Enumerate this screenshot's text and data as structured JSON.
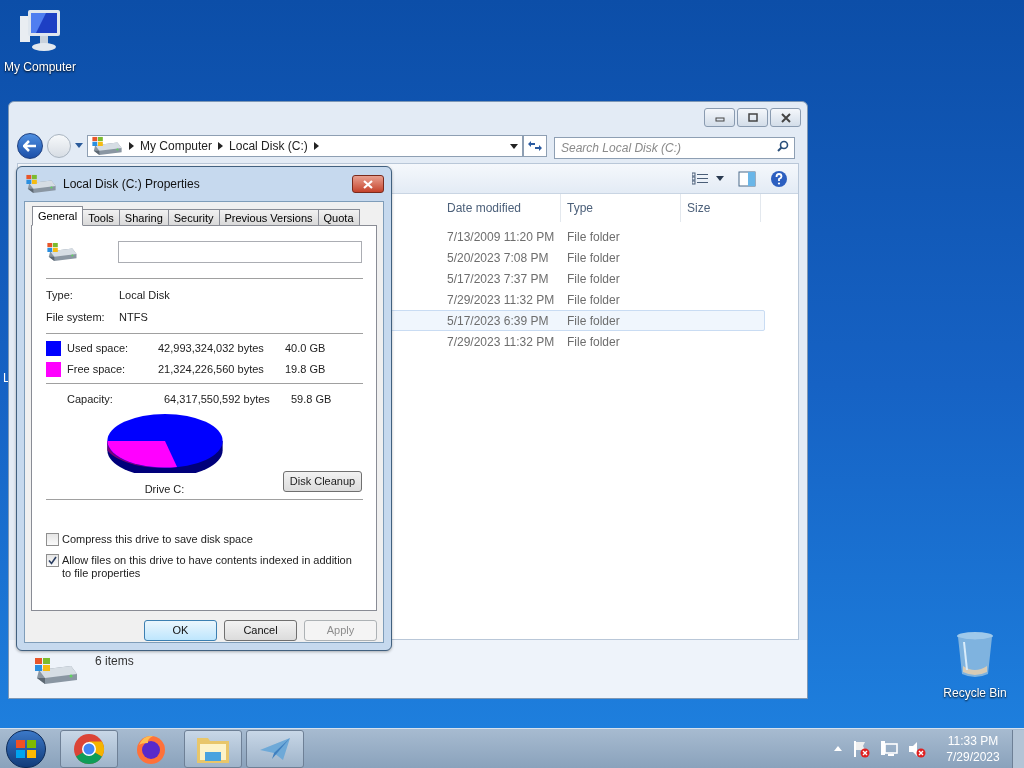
{
  "desktop_icons": [
    {
      "label": "My Computer",
      "kind": "computer"
    },
    {
      "label": "Recycle Bin",
      "kind": "bin"
    }
  ],
  "desktop_partial_label": "L",
  "explorer": {
    "address": [
      "My Computer",
      "Local Disk (C:)"
    ],
    "search_placeholder": "Search Local Disk (C:)",
    "columns": [
      "Date modified",
      "Type",
      "Size"
    ],
    "rows": [
      {
        "date_modified": "7/13/2009 11:20 PM",
        "type": "File folder",
        "selected": false
      },
      {
        "date_modified": "5/20/2023 7:08 PM",
        "type": "File folder",
        "selected": false
      },
      {
        "date_modified": "5/17/2023 7:37 PM",
        "type": "File folder",
        "selected": false
      },
      {
        "date_modified": "7/29/2023 11:32 PM",
        "type": "File folder",
        "selected": false
      },
      {
        "date_modified": "5/17/2023 6:39 PM",
        "type": "File folder",
        "selected": true
      },
      {
        "date_modified": "7/29/2023 11:32 PM",
        "type": "File folder",
        "selected": false
      }
    ],
    "status": "6 items"
  },
  "dialog": {
    "title": "Local Disk (C:) Properties",
    "tabs": [
      {
        "label": "General",
        "selected": true
      },
      {
        "label": "Tools",
        "selected": false
      },
      {
        "label": "Sharing",
        "selected": false
      },
      {
        "label": "Security",
        "selected": false
      },
      {
        "label": "Previous Versions",
        "selected": false
      },
      {
        "label": "Quota",
        "selected": false
      }
    ],
    "type_label": "Type:",
    "type_value": "Local Disk",
    "fs_label": "File system:",
    "fs_value": "NTFS",
    "space": [
      {
        "label": "Used space:",
        "bytes": "42,993,324,032 bytes",
        "size": "40.0 GB",
        "color": "#0000ff"
      },
      {
        "label": "Free space:",
        "bytes": "21,324,226,560 bytes",
        "size": "19.8 GB",
        "color": "#ff00ff"
      }
    ],
    "capacity": {
      "label": "Capacity:",
      "bytes": "64,317,550,592 bytes",
      "size": "59.8 GB"
    },
    "drive_label": "Drive C:",
    "cleanup_button": "Disk Cleanup",
    "options": [
      {
        "label": "Compress this drive to save disk space",
        "checked": false
      },
      {
        "label": "Allow files on this drive to have contents indexed in addition to file properties",
        "checked": true
      }
    ],
    "buttons": [
      {
        "label": "OK",
        "disabled": false
      },
      {
        "label": "Cancel",
        "disabled": false
      },
      {
        "label": "Apply",
        "disabled": true
      }
    ]
  },
  "taskbar": {
    "apps": [
      {
        "kind": "chrome",
        "running": true
      },
      {
        "kind": "firefox",
        "running": false
      },
      {
        "kind": "folder",
        "running": true
      },
      {
        "kind": "plane",
        "running": true
      }
    ],
    "time": "11:33 PM",
    "date": "7/29/2023"
  }
}
